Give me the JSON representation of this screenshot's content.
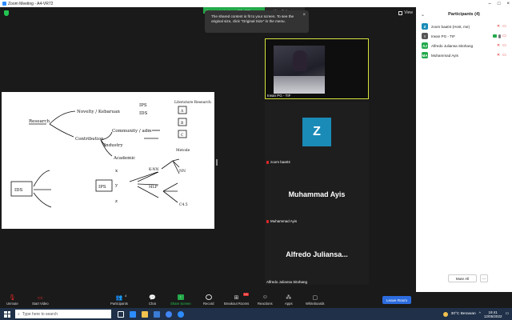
{
  "window": {
    "title": "Zoom Meeting - A4-VR72"
  },
  "banner": {
    "viewing_text": "You are viewing Irwan PG - TIF's screen",
    "view_options_label": "View Options ⌄"
  },
  "toast": {
    "text": "The shared content is fit to your screen. To see the original size, click \"Original Size\" in the menu."
  },
  "view_button_label": "View",
  "whiteboard": {
    "labels": [
      "Research",
      "Novelty / Kebaruan",
      "Contribution",
      "Community / adm",
      "Industry",
      "Academic",
      "IPS",
      "IDS",
      "Literature Research",
      "A",
      "B",
      "C",
      "Metode",
      "IDS",
      "IPS",
      "K-NN",
      "MLP",
      "NN",
      "C4.5",
      "x",
      "y",
      "z"
    ]
  },
  "tiles": [
    {
      "name": "Irwan PG - TIF"
    },
    {
      "name": "zoom baa04",
      "avatar": "Z"
    },
    {
      "name": "Muhammad Ayis",
      "big": "Muhammad Ayis"
    },
    {
      "name": "Alfredo Juliansa Sitohang",
      "big": "Alfredo  Juliansa..."
    }
  ],
  "panel": {
    "title": "Participants (4)",
    "participants": [
      {
        "initials": "Z",
        "name": "zoom baa04 (Host, me)",
        "color": "#1a8bb7"
      },
      {
        "initials": "I",
        "name": "Irwan PG - TIF",
        "color": "#555555"
      },
      {
        "initials": "AJ",
        "name": "Alfredo Juliansa Sitohang",
        "color": "#23a94a"
      },
      {
        "initials": "MA",
        "name": "Muhammad Ayis",
        "color": "#23a94a"
      }
    ],
    "mute_all_label": "Mute All",
    "more_label": "..."
  },
  "toolbar": {
    "unmute": "Unmute",
    "start_video": "Start Video",
    "participants": "Participants",
    "participants_count": "4",
    "chat": "Chat",
    "share_screen": "Share Screen",
    "record": "Record",
    "breakout_rooms": "Breakout Rooms",
    "breakout_badge": "1:1",
    "reactions": "Reactions",
    "apps": "Apps",
    "whiteboards": "Whiteboards",
    "leave": "Leave Room"
  },
  "taskbar": {
    "search_placeholder": "Type here to search",
    "weather": "30°C  Berawan",
    "time": "19:41",
    "date": "12/05/2022"
  }
}
